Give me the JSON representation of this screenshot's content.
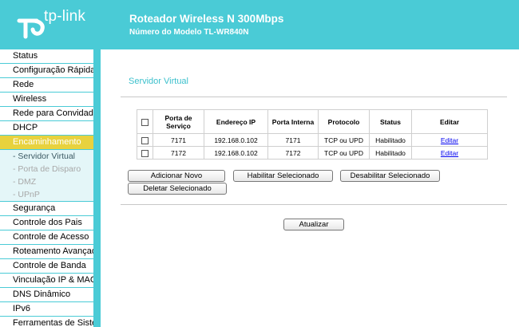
{
  "header": {
    "logo_text": "tp-link",
    "title": "Roteador Wireless N 300Mbps",
    "subtitle": "Número do Modelo TL-WR840N",
    "bg_color": "#4acbd6"
  },
  "sidebar": {
    "items_top": [
      {
        "label": "Status"
      },
      {
        "label": "Configuração Rápida"
      },
      {
        "label": "Rede"
      },
      {
        "label": "Wireless"
      },
      {
        "label": "Rede para Convidado"
      },
      {
        "label": "DHCP"
      },
      {
        "label": "Encaminhamento",
        "active": true
      }
    ],
    "sub_items": [
      {
        "label": "- Servidor Virtual",
        "current": true
      },
      {
        "label": "- Porta de Disparo"
      },
      {
        "label": "- DMZ"
      },
      {
        "label": "- UPnP"
      }
    ],
    "items_bottom": [
      {
        "label": "Segurança"
      },
      {
        "label": "Controle dos Pais"
      },
      {
        "label": "Controle de Acesso"
      },
      {
        "label": "Roteamento Avançado"
      },
      {
        "label": "Controle de Banda"
      },
      {
        "label": "Vinculação IP & MAC"
      },
      {
        "label": "DNS Dinâmico"
      },
      {
        "label": "IPv6"
      },
      {
        "label": "Ferramentas de Sistema"
      }
    ],
    "active_color": "#e8d23e"
  },
  "main": {
    "title": "Servidor Virtual",
    "table": {
      "headers": [
        "",
        "Porta de Serviço",
        "Endereço IP",
        "Porta Interna",
        "Protocolo",
        "Status",
        "Editar"
      ],
      "rows": [
        {
          "service_port": "7171",
          "ip": "192.168.0.102",
          "internal_port": "7171",
          "protocol": "TCP ou UPD",
          "status": "Habilitado",
          "edit": "Editar"
        },
        {
          "service_port": "7172",
          "ip": "192.168.0.102",
          "internal_port": "7172",
          "protocol": "TCP ou UPD",
          "status": "Habilitado",
          "edit": "Editar"
        }
      ]
    },
    "buttons": {
      "add_new": "Adicionar Novo",
      "enable_selected": "Habilitar Selecionado",
      "disable_selected": "Desabilitar Selecionado",
      "delete_selected": "Deletar Selecionado",
      "refresh": "Atualizar"
    }
  }
}
